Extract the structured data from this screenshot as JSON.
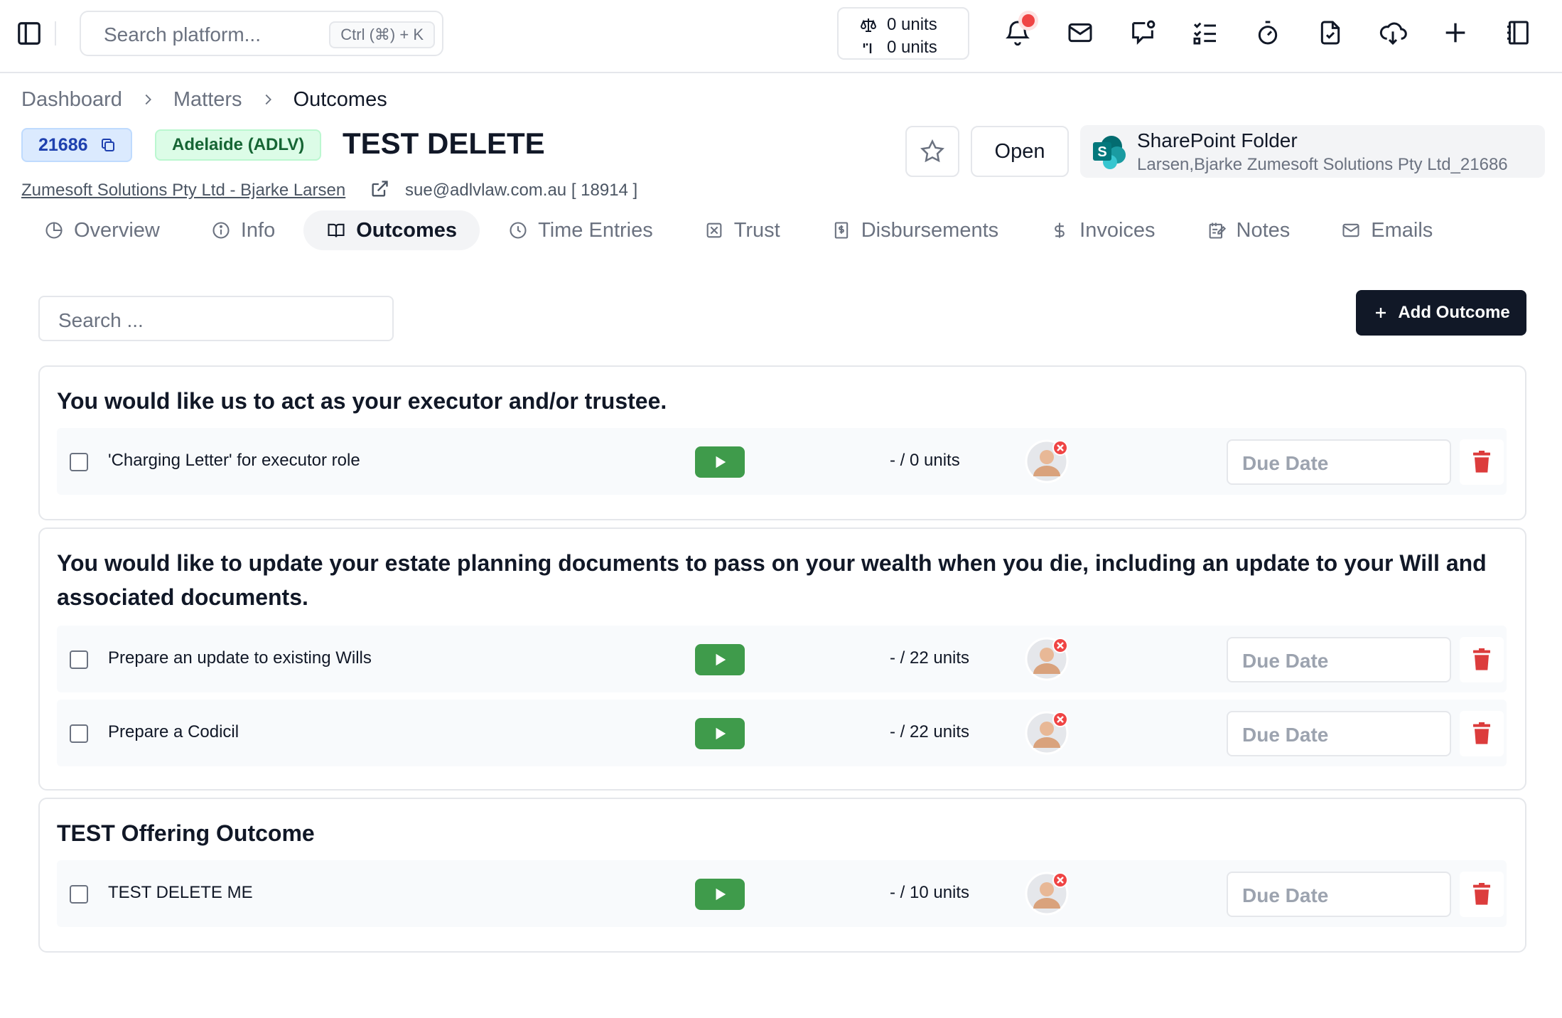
{
  "topbar": {
    "search_placeholder": "Search platform...",
    "search_shortcut": "Ctrl (⌘) + K",
    "units_top": "0 units",
    "units_bottom": "0 units",
    "icons": [
      "bell-icon",
      "mail-icon",
      "message-icon",
      "checklist-icon",
      "timer-icon",
      "document-icon",
      "download-cloud-icon",
      "plus-icon",
      "notebook-icon"
    ]
  },
  "breadcrumb": [
    "Dashboard",
    "Matters",
    "Outcomes"
  ],
  "matter": {
    "id": "21686",
    "office": "Adelaide (ADLV)",
    "title": "TEST DELETE",
    "client": "Zumesoft Solutions Pty Ltd - Bjarke Larsen",
    "email": "sue@adlvlaw.com.au [ 18914 ]",
    "open_label": "Open"
  },
  "sharepoint": {
    "title": "SharePoint Folder",
    "subtitle": "Larsen,Bjarke Zumesoft Solutions Pty Ltd_21686"
  },
  "tabs": [
    {
      "label": "Overview",
      "icon": "pie-icon"
    },
    {
      "label": "Info",
      "icon": "info-icon"
    },
    {
      "label": "Outcomes",
      "icon": "book-icon",
      "active": true
    },
    {
      "label": "Time Entries",
      "icon": "clock-icon"
    },
    {
      "label": "Trust",
      "icon": "trust-icon"
    },
    {
      "label": "Disbursements",
      "icon": "receipt-icon"
    },
    {
      "label": "Invoices",
      "icon": "dollar-icon"
    },
    {
      "label": "Notes",
      "icon": "note-icon"
    },
    {
      "label": "Emails",
      "icon": "mail-icon"
    }
  ],
  "outcomes": {
    "search_placeholder": "Search ...",
    "add_label": "Add Outcome",
    "due_placeholder": "Due Date",
    "groups": [
      {
        "title": "You would like us to act as your executor and/or trustee.",
        "tasks": [
          {
            "name": "'Charging Letter' for executor role",
            "units": "- / 0 units"
          }
        ]
      },
      {
        "title": "You would like to update your estate planning documents to pass on your wealth when you die, including an update to your Will and associated documents.",
        "tasks": [
          {
            "name": "Prepare an update to existing Wills",
            "units": "- / 22 units"
          },
          {
            "name": "Prepare a Codicil",
            "units": "- / 22 units"
          }
        ]
      },
      {
        "title": "TEST Offering Outcome",
        "tasks": [
          {
            "name": "TEST DELETE ME",
            "units": "- / 10 units"
          }
        ]
      }
    ]
  },
  "colors": {
    "accent_dark": "#111827",
    "play_green": "#3f9b4b",
    "delete_red": "#dc3c3c",
    "id_badge_bg": "#dbeafe",
    "office_badge_bg": "#dcfce7"
  }
}
